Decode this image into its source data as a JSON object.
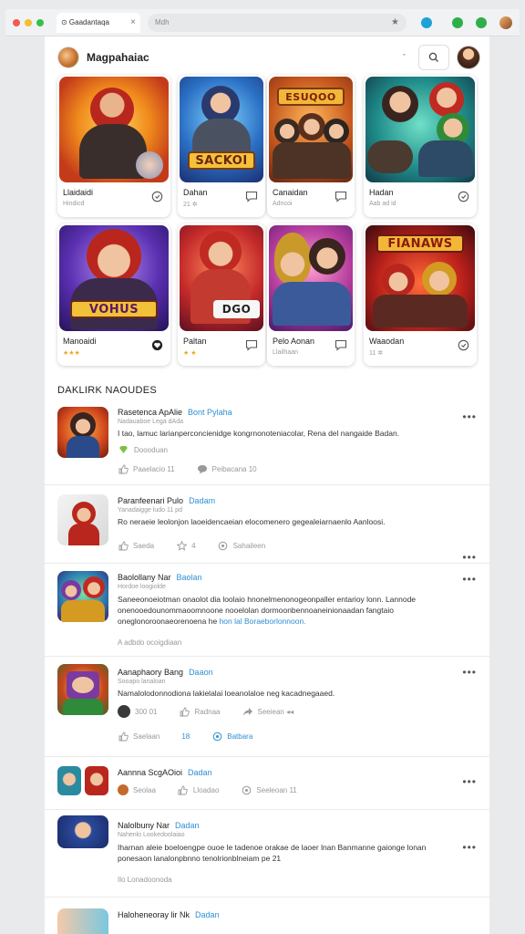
{
  "browser": {
    "tab_title": "⊙ Gaadantaqa",
    "tab_close": "×",
    "address_text": "Mdh",
    "star": "★"
  },
  "header": {
    "app_name": "Magpahaiac",
    "chevron": "ˇ"
  },
  "games": [
    {
      "title": "Llaidaidi",
      "sub": "Hindicd",
      "banner": ""
    },
    {
      "title": "Dahan",
      "sub": "21 ✲",
      "banner": "SACKOI"
    },
    {
      "title": "Canaidan",
      "sub": "Adncoi",
      "banner": "ESUQOO"
    },
    {
      "title": "Hadan",
      "sub": "Aab ad id",
      "banner": ""
    },
    {
      "title": "Manoaidi",
      "sub": "★★★",
      "banner": "VOHUS"
    },
    {
      "title": "Paltan",
      "sub": "★ ★",
      "banner": "DGO"
    },
    {
      "title": "Pelo Aonan",
      "sub": "Llailhaan",
      "banner": ""
    },
    {
      "title": "Waaodan",
      "sub": "11 ✲",
      "banner": "FIANAWS"
    }
  ],
  "section_label": "DAKLIRK NAOUDES",
  "feed": [
    {
      "title": "Rasetenca ApAlie",
      "tag": "Bont Pylaha",
      "meta": "Nadauaboe Lega dAda",
      "text": "I tao, lamuc larianperconcienidge kongrnonoteniacolar, Rena del nangaide Badan.",
      "link": "",
      "badge": "Doooduan",
      "actions": [
        {
          "label": "Paaelacio 11"
        },
        {
          "label": "Peibacana 10"
        }
      ]
    },
    {
      "title": "Paranfeenari Pulo",
      "tag": "Dadam",
      "meta": "Yanadaigge ludo 11 pd",
      "text": "Ro neraeie leolonjon laoeidencaeian elocomenero gegealeiarnaenlo Aanloosi.",
      "link": "",
      "badge": "",
      "actions": [
        {
          "label": "Saeda"
        },
        {
          "label": "4"
        },
        {
          "label": "Sahaileen"
        }
      ]
    },
    {
      "title": "Baolollany Nar",
      "tag": "Baolan",
      "meta": "Hordoe loogiolde",
      "text": "Saneeonoeiotman onaolot dia loolaio hnonelmenonogeonpaller entarioy lonn. Lannode onenooedounommaoomnoone nooelolan dormoonbennoaneinionaadan fangtaio oneglonoroonaeorenoena he",
      "link": "hon lal Boraeborlonnoon.",
      "badge": "",
      "actions": [
        {
          "label": "A adbdo ocoigdiaan"
        }
      ]
    },
    {
      "title": "Aanaphaory Bang",
      "tag": "Daaon",
      "meta": "Sooapo lanaloan",
      "text": "Namalolodonnodiona lakielalai loeanolaloe neg kacadnegaaed.",
      "link": "",
      "badge": "",
      "actions": [
        {
          "label": "300 01"
        },
        {
          "label": "Radnaa"
        },
        {
          "label": "Seeiean ◂◂"
        }
      ],
      "actions2": [
        {
          "label": "Saelaan"
        },
        {
          "label": "18"
        },
        {
          "label": "Batbara"
        }
      ]
    },
    {
      "title": "Aannna ScgAOioi",
      "tag": "Dadan",
      "meta": "",
      "text": "",
      "link": "",
      "badge": "",
      "actions": [
        {
          "label": "Seolaa"
        },
        {
          "label": "Lloadao"
        },
        {
          "label": "Seeleoan 11"
        }
      ]
    },
    {
      "title": "Nalolbuny Nar",
      "tag": "Dadan",
      "meta": "Nahenlo Lookedoolaiao",
      "text": "Iharnan aleie boeloengpe ouoe le tadenoe orakae de laoer lnan Banmanne gaionge lonan ponesaon lanalonpbnno tenolrionblneiam pe",
      "link": "21",
      "badge": "",
      "actions": [
        {
          "label": "Ilo Lonadoonoda"
        }
      ]
    },
    {
      "title": "Haloheneoray lir Nk",
      "tag": "Dadan",
      "meta": "",
      "text": "",
      "link": "",
      "badge": "",
      "actions": []
    }
  ],
  "more_label": "•••",
  "colors": {
    "accent": "#2b8fd6",
    "stars": "#f2a31b",
    "badge_green": "#7bc043"
  }
}
